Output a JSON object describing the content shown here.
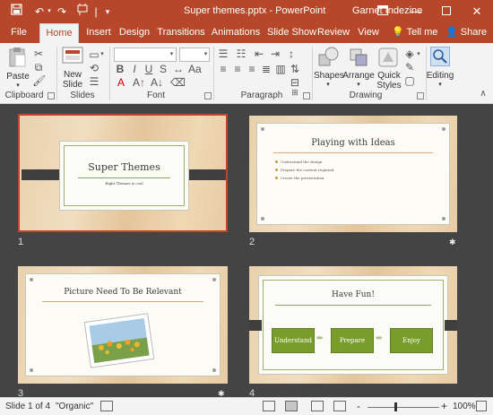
{
  "titlebar": {
    "title": "Super themes.pptx - PowerPoint",
    "user": "Garnet Indezine",
    "accent_color": "#b7472a",
    "icons": [
      "save-icon",
      "undo-icon",
      "redo-icon",
      "format-painter-icon",
      "customize-icon"
    ]
  },
  "tabs": [
    "File",
    "Home",
    "Insert",
    "Design",
    "Transitions",
    "Animations",
    "Slide Show",
    "Review",
    "View"
  ],
  "active_tab": "Home",
  "tell_me": "Tell me",
  "share": "Share",
  "ribbon": {
    "groups": {
      "clipboard": "Clipboard",
      "slides": "Slides",
      "font": "Font",
      "paragraph": "Paragraph",
      "drawing": "Drawing"
    },
    "paste": "Paste",
    "new_slide": "New Slide",
    "shapes": "Shapes",
    "arrange": "Arrange",
    "quick_styles": "Quick Styles",
    "editing": "Editing",
    "font_buttons": {
      "bold": "B",
      "italic": "I",
      "underline": "U",
      "strikethrough": "S"
    }
  },
  "slides": [
    {
      "number": "1",
      "title": "Super Themes",
      "subtitle": "Right Themes is cool",
      "selected": true,
      "has_star": false
    },
    {
      "number": "2",
      "title": "Playing with Ideas",
      "bullets": [
        "Understand the design",
        "Prepare the content required",
        "Create the presentation"
      ],
      "has_star": true
    },
    {
      "number": "3",
      "title": "Picture Need To Be Relevant",
      "has_star": true
    },
    {
      "number": "4",
      "title": "Have Fun!",
      "boxes": [
        "Understand",
        "Prepare",
        "Enjoy"
      ],
      "has_star": false
    }
  ],
  "status": {
    "slide": "Slide 1 of 4",
    "theme": "\"Organic\"",
    "zoom": "100%",
    "zoom_minus": "-",
    "zoom_plus": "+"
  }
}
